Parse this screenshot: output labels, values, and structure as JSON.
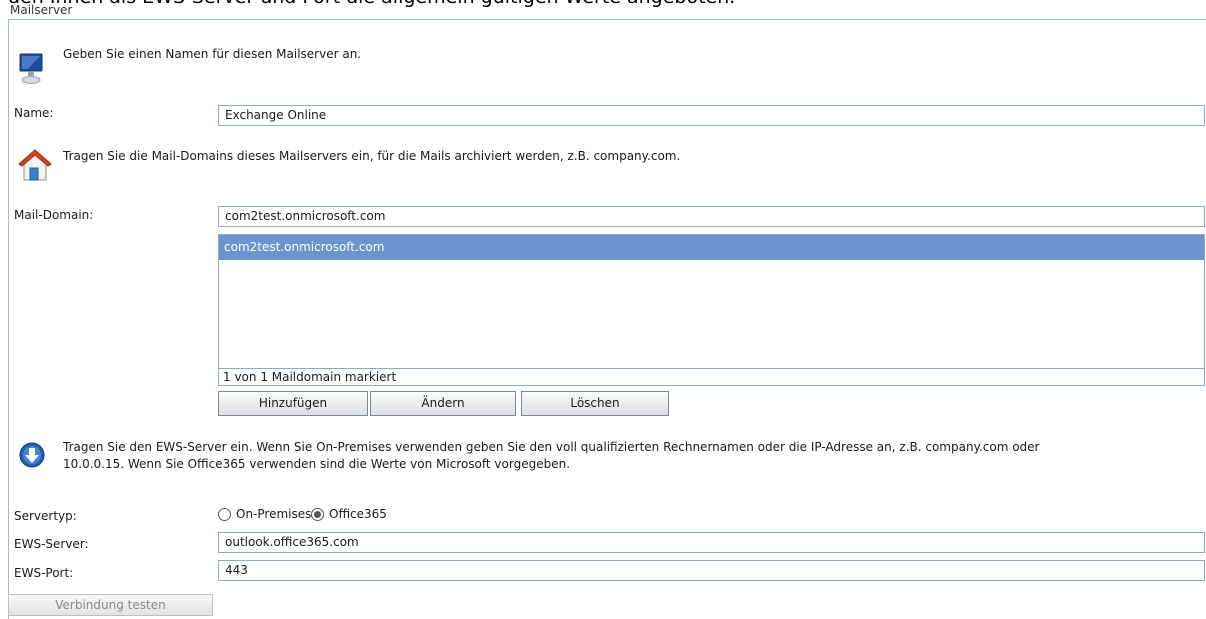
{
  "intro_text_cut": "den Ihnen als EWS-Server und Port die allgemein gültigen Werte angeboten.",
  "section": {
    "legend": "Mailserver"
  },
  "name_block": {
    "info": "Geben Sie einen Namen für diesen Mailserver an.",
    "label": "Name:",
    "value": "Exchange Online",
    "icon": "monitor-icon"
  },
  "domain_block": {
    "info": "Tragen Sie die Mail-Domains dieses Mailservers ein, für die Mails archiviert werden, z.B. company.com.",
    "icon": "house-icon",
    "label": "Mail-Domain:",
    "value": "com2test.onmicrosoft.com",
    "list": [
      "com2test.onmicrosoft.com"
    ],
    "status": "1 von 1 Maildomain markiert",
    "buttons": {
      "add": "Hinzufügen",
      "edit": "Ändern",
      "delete": "Löschen"
    },
    "selected_color": "#6b95cc"
  },
  "ews_block": {
    "icon": "download-arrow-icon",
    "info_line1": "Tragen Sie den EWS-Server ein. Wenn Sie On-Premises verwenden geben Sie den voll qualifizierten Rechnernamen oder die IP-Adresse an, z.B. company.com oder",
    "info_line2": "10.0.0.15. Wenn Sie Office365 verwenden sind die Werte von Microsoft vorgegeben.",
    "servertype_label": "Servertyp:",
    "option_onprem": "On-Premises",
    "option_o365": "Office365",
    "selected_option": "Office365",
    "server_label": "EWS-Server:",
    "server_value": "outlook.office365.com",
    "port_label": "EWS-Port:",
    "port_value": "443"
  },
  "test_button": "Verbindung testen"
}
